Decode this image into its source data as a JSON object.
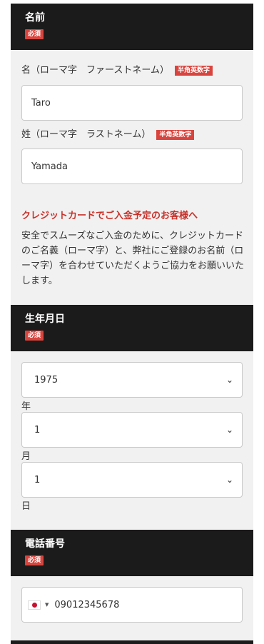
{
  "name_section": {
    "title": "名前",
    "required": "必須",
    "first_name_label": "名（ローマ字　ファーストネーム）",
    "first_name_badge": "半角英数字",
    "first_name_value": "Taro",
    "last_name_label": "姓（ローマ字　ラストネーム）",
    "last_name_badge": "半角英数字",
    "last_name_value": "Yamada"
  },
  "notice": {
    "title": "クレジットカードでご入金予定のお客様へ",
    "body": "安全でスムーズなご入金のために、クレジットカードのご名義（ローマ字）と、弊社にご登録のお名前（ローマ字）を合わせていただくようご協力をお願いいたします。"
  },
  "birth_section": {
    "title": "生年月日",
    "required": "必須",
    "year_value": "1975",
    "year_label": "年",
    "month_value": "1",
    "month_label": "月",
    "day_value": "1",
    "day_label": "日"
  },
  "phone_section": {
    "title": "電話番号",
    "required": "必須",
    "country_icon": "japan-flag-icon",
    "phone_value": "09012345678"
  },
  "colors": {
    "header_bg": "#1c1b1b",
    "required_bg": "#d9453e",
    "notice_red": "#c8322a"
  }
}
